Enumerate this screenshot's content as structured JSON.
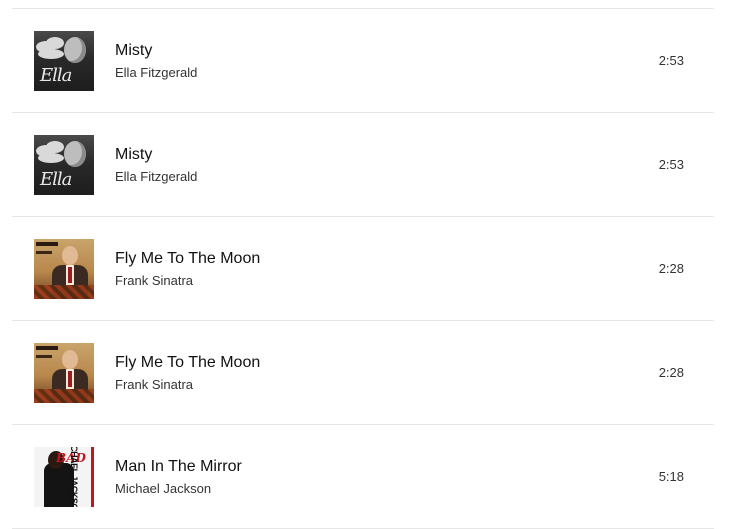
{
  "tracks": [
    {
      "title": "Misty",
      "artist": "Ella Fitzgerald",
      "duration": "2:53",
      "art": "ella-album-art",
      "art_text": "Ella"
    },
    {
      "title": "Misty",
      "artist": "Ella Fitzgerald",
      "duration": "2:53",
      "art": "ella-album-art",
      "art_text": "Ella"
    },
    {
      "title": "Fly Me To The Moon",
      "artist": "Frank Sinatra",
      "duration": "2:28",
      "art": "sinatra-album-art"
    },
    {
      "title": "Fly Me To The Moon",
      "artist": "Frank Sinatra",
      "duration": "2:28",
      "art": "sinatra-album-art"
    },
    {
      "title": "Man In The Mirror",
      "artist": "Michael Jackson",
      "duration": "5:18",
      "art": "bad-album-art",
      "art_text": "BAD",
      "art_side_text": "MICHAEL JACKSON"
    }
  ],
  "colors": {
    "background": "#ffffff",
    "divider": "#e6e6e6",
    "title_text": "#111111",
    "secondary_text": "#333333"
  }
}
